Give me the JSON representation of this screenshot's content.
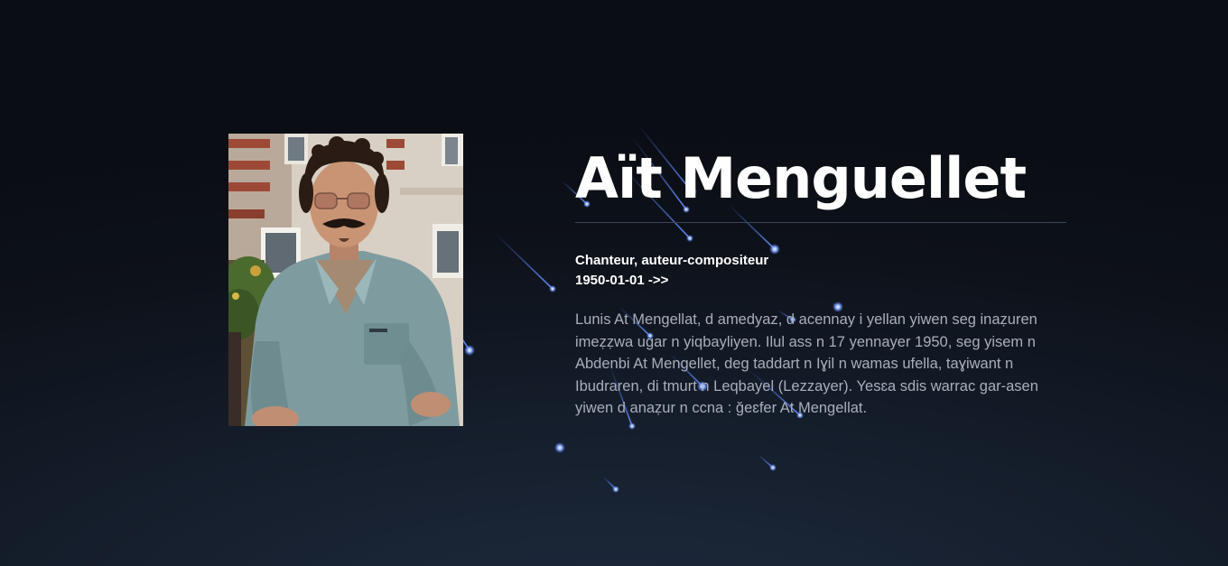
{
  "person": {
    "name": "Aït Menguellet",
    "role": "Chanteur, auteur-compositeur",
    "dates": "1950-01-01 ->>",
    "bio": "Lunis At Mengellat, d amedyaz, d acennay i yellan yiwen seg inaẓuren imeẓẓwa ugar n yiqbayliyen. Ilul ass n 17 yennayer 1950, seg yisem n Abdenbi At Mengellet, deg taddart n Iɣil n wamas ufella, taɣiwant n Ibudraren, di tmurt n Leqbayel (Lezzayer). Yesɛa sdis warrac gar-asen yiwen d anaẓur n ccna : ğeɛfer At Mengellat."
  },
  "colors": {
    "background": "#0d1119",
    "meteor": "#4f7bff",
    "bio_text": "#a9aebb"
  }
}
